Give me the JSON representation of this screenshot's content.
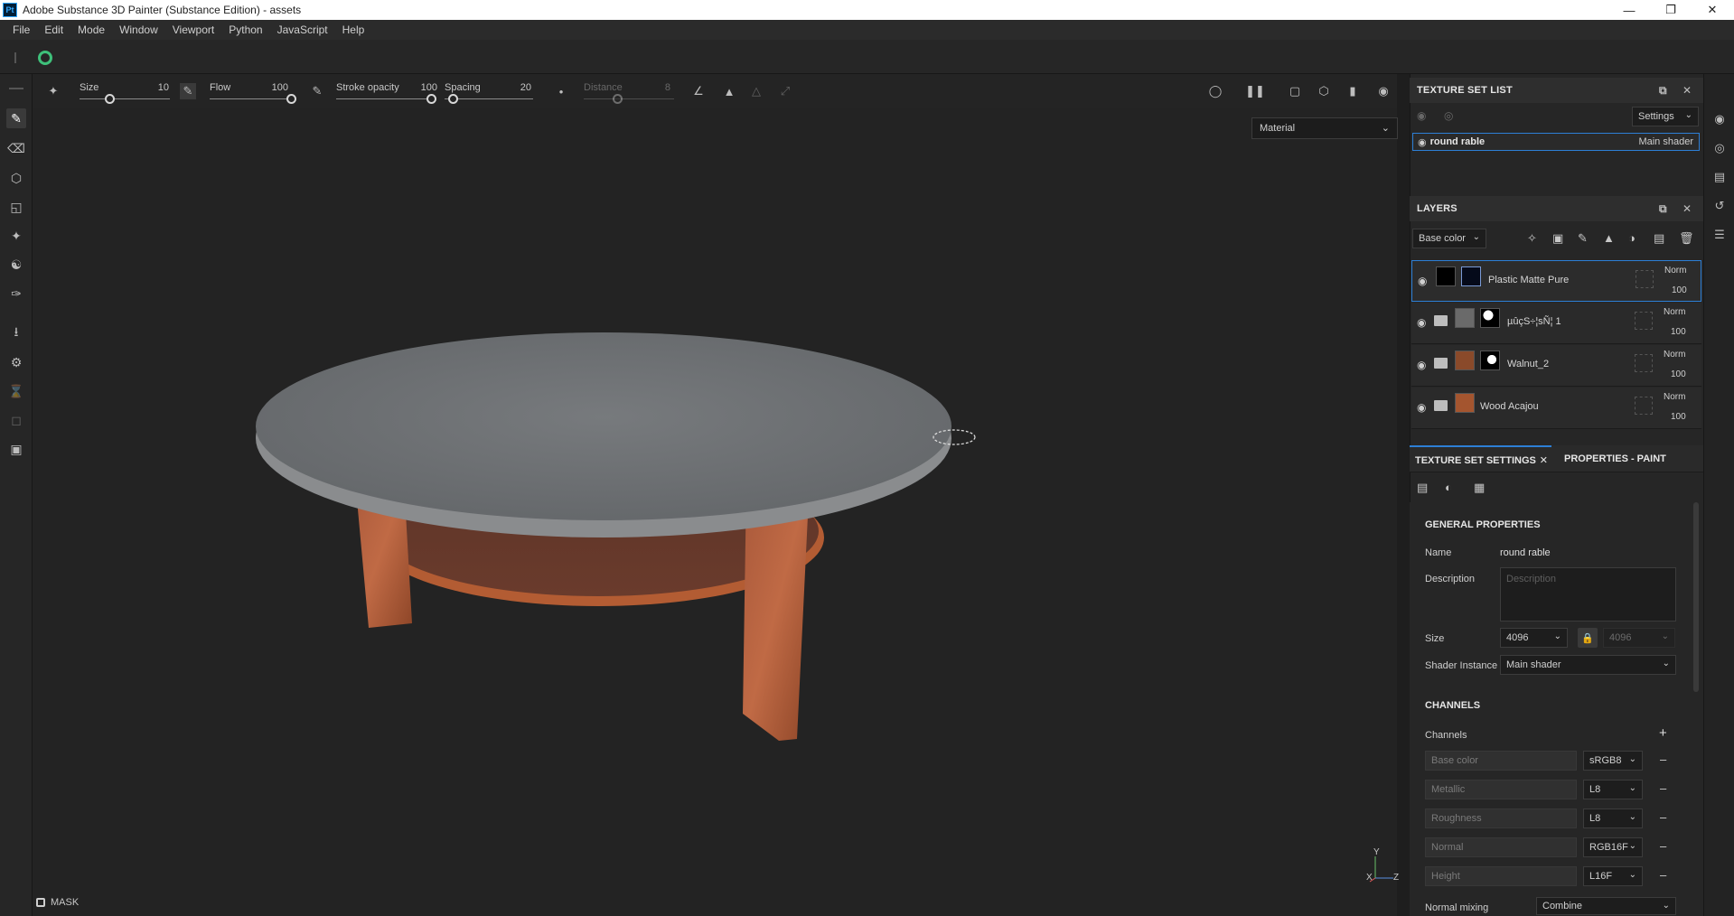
{
  "window": {
    "app_icon": "Pt",
    "title": "Adobe Substance 3D Painter (Substance Edition) - assets",
    "controls": [
      "minimize-icon",
      "maximize-icon",
      "close-icon"
    ]
  },
  "menu": [
    "File",
    "Edit",
    "Mode",
    "Window",
    "Viewport",
    "Python",
    "JavaScript",
    "Help"
  ],
  "tool_options": {
    "size_label": "Size",
    "size_value": "10",
    "flow_label": "Flow",
    "flow_value": "100",
    "stroke_opacity_label": "Stroke opacity",
    "stroke_opacity_value": "100",
    "spacing_label": "Spacing",
    "spacing_value": "20",
    "distance_label": "Distance",
    "distance_value": "8"
  },
  "viewport": {
    "display_mode": "Material",
    "mask_label": "MASK",
    "axis": {
      "y": "Y",
      "x": "X",
      "z": "Z"
    }
  },
  "texture_set_list": {
    "title": "TEXTURE SET LIST",
    "settings_label": "Settings",
    "items": [
      {
        "name": "round rable",
        "shader": "Main shader"
      }
    ]
  },
  "layers": {
    "title": "LAYERS",
    "channel": "Base color",
    "items": [
      {
        "name": "Plastic Matte Pure",
        "blend": "Norm",
        "opacity": "100"
      },
      {
        "name": "µûçS÷¦sÑ¦ 1",
        "blend": "Norm",
        "opacity": "100"
      },
      {
        "name": "Walnut_2",
        "blend": "Norm",
        "opacity": "100"
      },
      {
        "name": "Wood Acajou",
        "blend": "Norm",
        "opacity": "100"
      }
    ]
  },
  "tabs": {
    "texture_set_settings": "TEXTURE SET SETTINGS",
    "properties_paint": "PROPERTIES - PAINT"
  },
  "general_properties": {
    "title": "GENERAL PROPERTIES",
    "name_label": "Name",
    "name_value": "round rable",
    "description_label": "Description",
    "description_placeholder": "Description",
    "size_label": "Size",
    "size_value": "4096",
    "size_value_locked": "4096",
    "shader_label": "Shader Instance",
    "shader_value": "Main shader"
  },
  "channels": {
    "title": "CHANNELS",
    "channels_label": "Channels",
    "items": [
      {
        "name": "Base color",
        "format": "sRGB8"
      },
      {
        "name": "Metallic",
        "format": "L8"
      },
      {
        "name": "Roughness",
        "format": "L8"
      },
      {
        "name": "Normal",
        "format": "RGB16F"
      },
      {
        "name": "Height",
        "format": "L16F"
      }
    ],
    "normal_mixing_label": "Normal mixing",
    "normal_mixing_value": "Combine"
  },
  "colors": {
    "accent": "#2d7fd6",
    "table_top": "#6f7275",
    "wood": "#b5603a"
  }
}
